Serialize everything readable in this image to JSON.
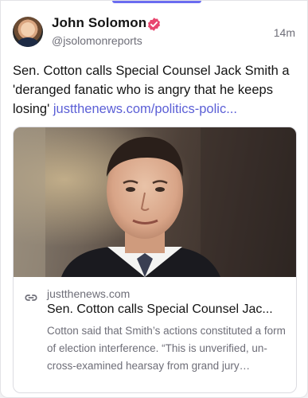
{
  "post": {
    "author_name": "John Solomon",
    "handle": "@jsolomonreports",
    "time": "14m",
    "verified": true,
    "text": "Sen. Cotton calls Special Counsel Jack Smith a 'deranged fanatic who is angry that he keeps losing' ",
    "link_text": "justthenews.com/politics-polic..."
  },
  "link_card": {
    "domain": "justthenews.com",
    "title": "Sen. Cotton calls Special Counsel Jac...",
    "description": "Cotton said that Smith’s actions constituted a form of election interference. “This is unverified, un-cross-examined hearsay from grand jury testimony, which usually isn’t rev..."
  },
  "colors": {
    "accent": "#6b6cf0",
    "link": "#5b5fd6",
    "verified_badge": "#e8466f",
    "muted_text": "#6e6e78"
  },
  "icons": {
    "verified": "verified-badge-icon",
    "link": "link-icon"
  }
}
